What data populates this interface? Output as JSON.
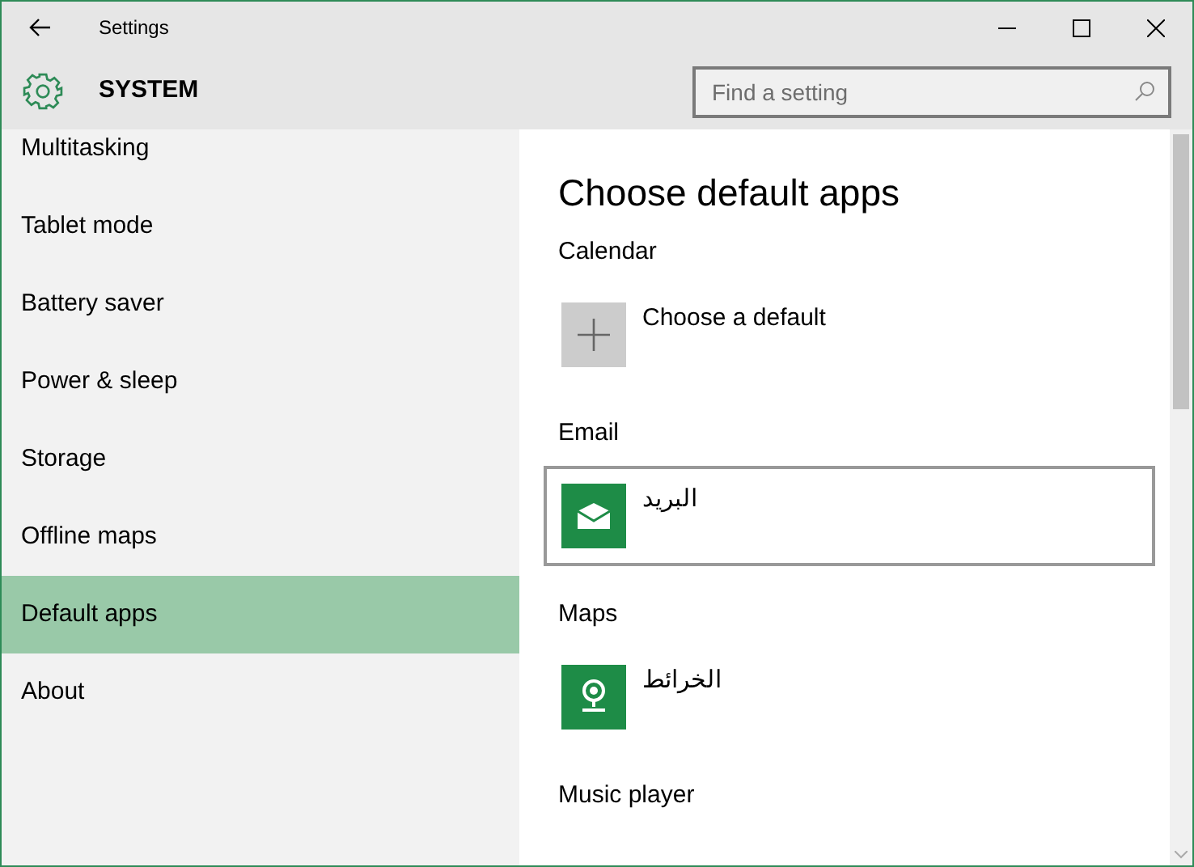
{
  "window": {
    "title": "Settings"
  },
  "header": {
    "title": "SYSTEM",
    "search": {
      "placeholder": "Find a setting"
    }
  },
  "sidebar": {
    "items": [
      {
        "label": "Multitasking",
        "selected": false
      },
      {
        "label": "Tablet mode",
        "selected": false
      },
      {
        "label": "Battery saver",
        "selected": false
      },
      {
        "label": "Power & sleep",
        "selected": false
      },
      {
        "label": "Storage",
        "selected": false
      },
      {
        "label": "Offline maps",
        "selected": false
      },
      {
        "label": "Default apps",
        "selected": true
      },
      {
        "label": "About",
        "selected": false
      }
    ]
  },
  "content": {
    "title": "Choose default apps",
    "sections": [
      {
        "label": "Calendar",
        "app": {
          "kind": "add",
          "name": "Choose a default",
          "focused": false
        }
      },
      {
        "label": "Email",
        "app": {
          "kind": "mail",
          "name": "البريد",
          "focused": true
        }
      },
      {
        "label": "Maps",
        "app": {
          "kind": "maps",
          "name": "الخرائط",
          "focused": false
        }
      },
      {
        "label": "Music player"
      }
    ]
  }
}
